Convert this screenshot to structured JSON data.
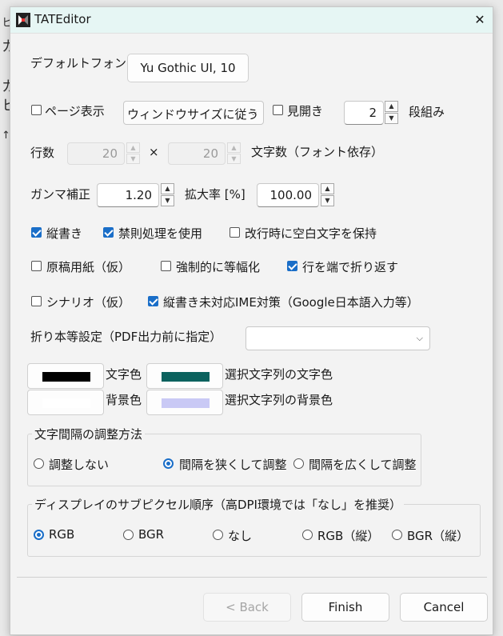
{
  "window": {
    "title": "TATEditor"
  },
  "font": {
    "label": "デフォルトフォント",
    "button": "Yu Gothic UI, 10"
  },
  "page": {
    "page_view": {
      "label": "ページ表示",
      "checked": false
    },
    "size_select": {
      "value": "ウィンドウサイズに従う"
    },
    "spread": {
      "label": "見開き",
      "checked": false
    },
    "columns": {
      "value": "2",
      "label": "段組み"
    }
  },
  "grid": {
    "rows_label": "行数",
    "rows": "20",
    "times": "×",
    "cols": "20",
    "cols_label": "文字数（フォント依存）"
  },
  "gamma": {
    "label": "ガンマ補正",
    "value": "1.20",
    "zoom_label": "拡大率 [%]",
    "zoom": "100.00"
  },
  "options": [
    {
      "label": "縦書き",
      "checked": true
    },
    {
      "label": "禁則処理を使用",
      "checked": true
    },
    {
      "label": "改行時に空白文字を保持",
      "checked": false
    },
    {
      "label": "原稿用紙（仮）",
      "checked": false
    },
    {
      "label": "強制的に等幅化",
      "checked": false
    },
    {
      "label": "行を端で折り返す",
      "checked": true
    },
    {
      "label": "シナリオ（仮）",
      "checked": false
    },
    {
      "label": "縦書き未対応IME対策（Google日本語入力等）",
      "checked": true
    }
  ],
  "fold": {
    "label": "折り本等設定（PDF出力前に指定）",
    "value": ""
  },
  "colors": {
    "text_label": "文字色",
    "text_color": "#000000",
    "sel_text_label": "選択文字列の文字色",
    "sel_text_color": "#0b625e",
    "bg_label": "背景色",
    "bg_color": "#ffffff",
    "sel_bg_label": "選択文字列の背景色",
    "sel_bg_color": "#c9c9f5"
  },
  "spacing": {
    "title": "文字間隔の調整方法",
    "options": [
      {
        "label": "調整しない",
        "checked": false
      },
      {
        "label": "間隔を狭くして調整",
        "checked": true
      },
      {
        "label": "間隔を広くして調整",
        "checked": false
      }
    ]
  },
  "subpixel": {
    "title": "ディスプレイのサブピクセル順序（高DPI環境では「なし」を推奨）",
    "options": [
      {
        "label": "RGB",
        "checked": true
      },
      {
        "label": "BGR",
        "checked": false
      },
      {
        "label": "なし",
        "checked": false
      },
      {
        "label": "RGB（縦）",
        "checked": false
      },
      {
        "label": "BGR（縦）",
        "checked": false
      }
    ]
  },
  "buttons": {
    "back": "< Back",
    "finish": "Finish",
    "cancel": "Cancel"
  },
  "background": {
    "t1": "ヒ",
    "t2": "カ",
    "t3": "カ",
    "t4": "ヒ",
    "t5": "↑l"
  }
}
